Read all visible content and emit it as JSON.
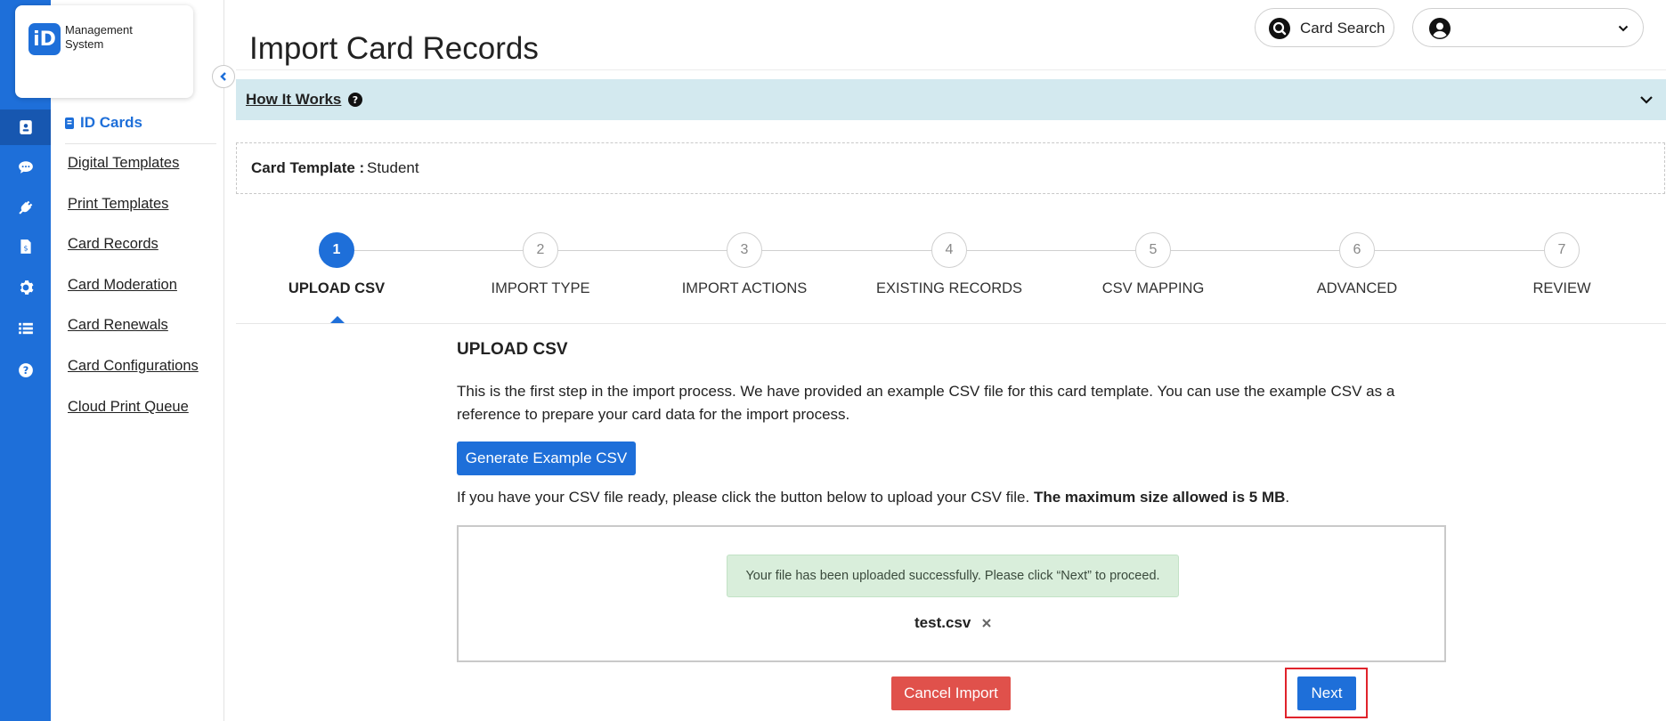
{
  "app": {
    "logo_mark": "iD",
    "logo_text": "Management System"
  },
  "rail": {
    "items": [
      {
        "icon": "id-card-icon",
        "active": true
      },
      {
        "icon": "chat-icon",
        "active": false
      },
      {
        "icon": "plug-icon",
        "active": false
      },
      {
        "icon": "invoice-icon",
        "active": false
      },
      {
        "icon": "gear-icon",
        "active": false
      },
      {
        "icon": "list-icon",
        "active": false
      },
      {
        "icon": "help-icon",
        "active": false
      }
    ]
  },
  "sidebar": {
    "title": "ID Cards",
    "items": [
      {
        "label": "Digital Templates"
      },
      {
        "label": "Print Templates"
      },
      {
        "label": "Card Records"
      },
      {
        "label": "Card Moderation"
      },
      {
        "label": "Card Renewals"
      },
      {
        "label": "Card Configurations"
      },
      {
        "label": "Cloud Print Queue"
      }
    ]
  },
  "header": {
    "title": "Import Card Records",
    "card_search_label": "Card Search",
    "user_name": ""
  },
  "how_it_works": {
    "label": "How It Works"
  },
  "template": {
    "label": "Card Template :",
    "value": "Student"
  },
  "stepper": {
    "steps": [
      {
        "number": "1",
        "label": "UPLOAD CSV",
        "active": true
      },
      {
        "number": "2",
        "label": "IMPORT TYPE",
        "active": false
      },
      {
        "number": "3",
        "label": "IMPORT ACTIONS",
        "active": false
      },
      {
        "number": "4",
        "label": "EXISTING RECORDS",
        "active": false
      },
      {
        "number": "5",
        "label": "CSV MAPPING",
        "active": false
      },
      {
        "number": "6",
        "label": "ADVANCED",
        "active": false
      },
      {
        "number": "7",
        "label": "REVIEW",
        "active": false
      }
    ]
  },
  "upload": {
    "title": "UPLOAD CSV",
    "intro": "This is the first step in the import process. We have provided an example CSV file for this card template. You can use the example CSV as a reference to prepare your card data for the import process.",
    "generate_button": "Generate Example CSV",
    "ready_text": "If you have your CSV file ready, please click the button below to upload your CSV file. ",
    "ready_bold": "The maximum size allowed is 5 MB",
    "ready_end": ".",
    "success_message": "Your file has been uploaded successfully. Please click “Next” to proceed.",
    "file_name": "test.csv"
  },
  "actions": {
    "cancel_label": "Cancel Import",
    "next_label": "Next"
  },
  "colors": {
    "primary": "#1e6fd9",
    "danger": "#e0514b",
    "success_bg": "#d9eedb",
    "info_bg": "#d3e9ef",
    "highlight": "#e0232b"
  }
}
